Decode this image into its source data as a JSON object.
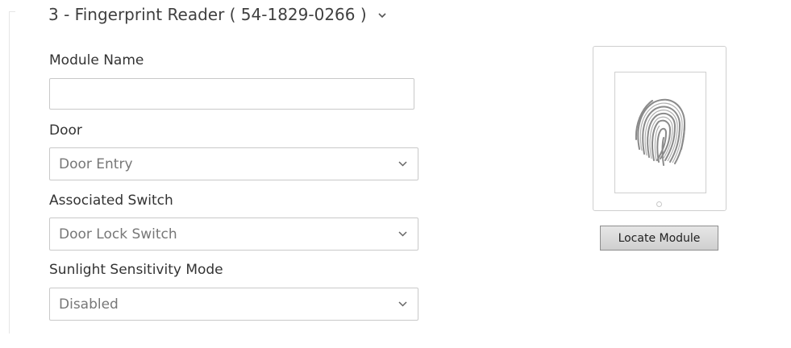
{
  "section": {
    "title": "3 - Fingerprint Reader ( 54-1829-0266 )",
    "chevron_icon": "chevron-down-icon"
  },
  "fields": {
    "module_name": {
      "label": "Module Name",
      "value": "",
      "placeholder": ""
    },
    "door": {
      "label": "Door",
      "selected": "Door Entry"
    },
    "associated_switch": {
      "label": "Associated Switch",
      "selected": "Door Lock Switch"
    },
    "sunlight_mode": {
      "label": "Sunlight Sensitivity Mode",
      "selected": "Disabled"
    }
  },
  "module_preview": {
    "image_icon": "fingerprint-icon",
    "led_icon": "status-led-icon",
    "locate_button_label": "Locate Module"
  },
  "colors": {
    "border": "#c9c9c9",
    "select_text": "#777777",
    "button_bg": "#d6d6d6"
  }
}
